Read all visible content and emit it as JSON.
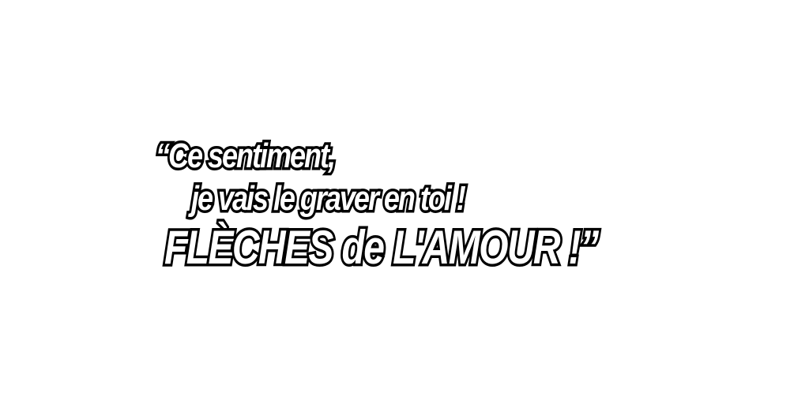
{
  "quote": {
    "line1": "“Ce sentiment,",
    "line2": "je vais le graver en toi !",
    "line3": "FLÈCHES de L'AMOUR !”"
  },
  "colors": {
    "background": "#ffffff",
    "text_fill": "#ffffff",
    "text_outline": "#000000"
  }
}
